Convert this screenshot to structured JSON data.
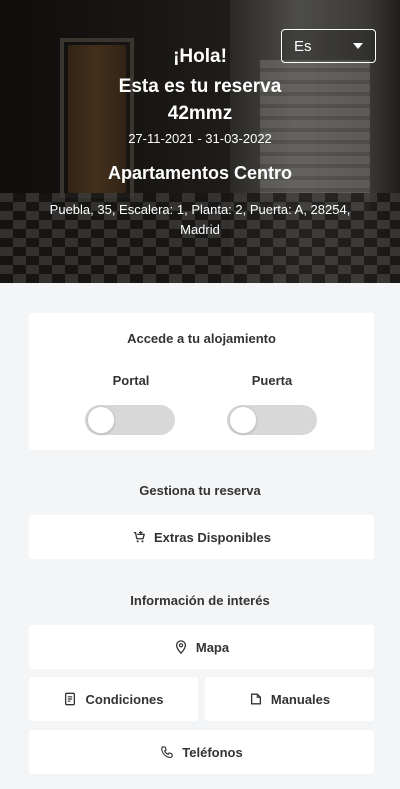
{
  "hero": {
    "greeting": "¡Hola!",
    "subtitle": "Esta es tu reserva",
    "reservation_code": "42mmz",
    "dates": "27-11-2021 - 31-03-2022",
    "apartment_name": "Apartamentos Centro",
    "address": "Puebla, 35, Escalera: 1, Planta: 2, Puerta: A, 28254, Madrid"
  },
  "language_select": {
    "selected": "Es"
  },
  "access": {
    "title": "Accede a tu alojamiento",
    "locks": [
      {
        "label": "Portal",
        "on": false
      },
      {
        "label": "Puerta",
        "on": false
      }
    ]
  },
  "manage": {
    "title": "Gestiona tu reserva",
    "extras_label": "Extras Disponibles"
  },
  "info": {
    "title": "Información de interés",
    "map_label": "Mapa",
    "conditions_label": "Condiciones",
    "manuals_label": "Manuales",
    "phones_label": "Teléfonos"
  },
  "colors": {
    "background": "#f4f5f7",
    "card": "#ffffff",
    "toggle_off": "#d8d8d8",
    "text": "#333333"
  },
  "icons": [
    "cart-icon",
    "map-pin-icon",
    "document-icon",
    "file-icon",
    "phone-icon",
    "caret-down-icon"
  ]
}
